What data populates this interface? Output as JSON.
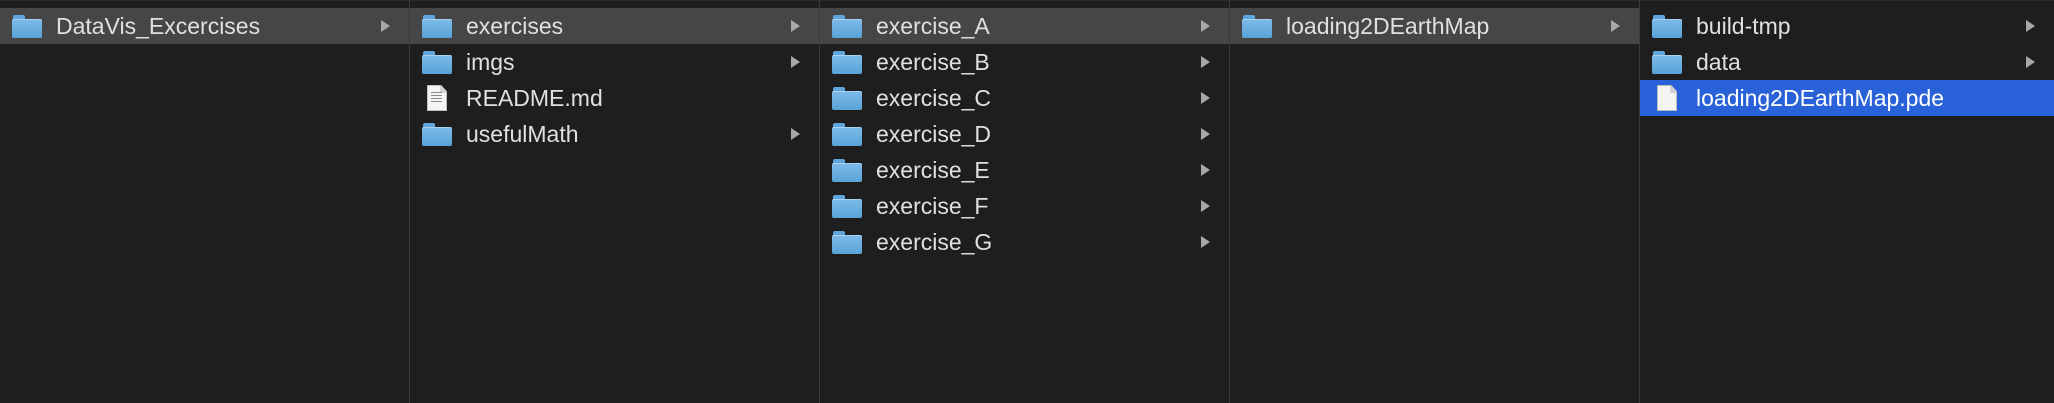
{
  "columns": [
    {
      "items": [
        {
          "label": "DataVis_Excercises",
          "type": "folder",
          "arrow": true,
          "state": "path"
        }
      ]
    },
    {
      "items": [
        {
          "label": "exercises",
          "type": "folder",
          "arrow": true,
          "state": "path"
        },
        {
          "label": "imgs",
          "type": "folder",
          "arrow": true,
          "state": "none"
        },
        {
          "label": "README.md",
          "type": "text-file",
          "arrow": false,
          "state": "none"
        },
        {
          "label": "usefulMath",
          "type": "folder",
          "arrow": true,
          "state": "none"
        }
      ]
    },
    {
      "items": [
        {
          "label": "exercise_A",
          "type": "folder",
          "arrow": true,
          "state": "path"
        },
        {
          "label": "exercise_B",
          "type": "folder",
          "arrow": true,
          "state": "none"
        },
        {
          "label": "exercise_C",
          "type": "folder",
          "arrow": true,
          "state": "none"
        },
        {
          "label": "exercise_D",
          "type": "folder",
          "arrow": true,
          "state": "none"
        },
        {
          "label": "exercise_E",
          "type": "folder",
          "arrow": true,
          "state": "none"
        },
        {
          "label": "exercise_F",
          "type": "folder",
          "arrow": true,
          "state": "none"
        },
        {
          "label": "exercise_G",
          "type": "folder",
          "arrow": true,
          "state": "none"
        }
      ]
    },
    {
      "items": [
        {
          "label": "loading2DEarthMap",
          "type": "folder",
          "arrow": true,
          "state": "path"
        }
      ]
    },
    {
      "items": [
        {
          "label": "build-tmp",
          "type": "folder",
          "arrow": true,
          "state": "none"
        },
        {
          "label": "data",
          "type": "folder",
          "arrow": true,
          "state": "none"
        },
        {
          "label": "loading2DEarthMap.pde",
          "type": "plain-file",
          "arrow": false,
          "state": "active"
        }
      ]
    }
  ],
  "colors": {
    "background": "#1e1e1e",
    "path_selection": "#464646",
    "active_selection": "#2962d8",
    "folder": "#6cb1e3"
  }
}
